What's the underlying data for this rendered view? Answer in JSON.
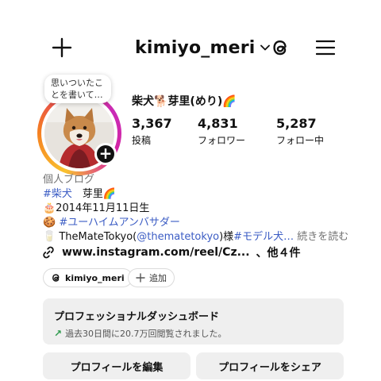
{
  "header": {
    "username": "kimiyo_meri",
    "icons": [
      "plus-icon",
      "chevron-down-icon",
      "threads-icon",
      "hamburger-menu-icon"
    ]
  },
  "profile": {
    "note": "思いついたことを書いて…",
    "display_name": "柴犬🐕芽里(めり)🌈",
    "stats": {
      "posts": {
        "value": "3,367",
        "label": "投稿"
      },
      "followers": {
        "value": "4,831",
        "label": "フォロワー"
      },
      "following": {
        "value": "5,287",
        "label": "フォロー中"
      }
    }
  },
  "bio": {
    "category": "個人ブログ",
    "line1_tag": "#柴犬",
    "line1_text": "　芽里🌈",
    "line2": "🎂2014年11月11日生",
    "line3_emoji": "🍪",
    "line3_tag": "#ユーハイムアンバサダー",
    "line4_emoji": "🥛",
    "line4_text_a": "TheMateTokyo(",
    "line4_mention": "@thematetokyo",
    "line4_text_b": ")様",
    "line4_tag": "#モデル犬…",
    "line4_more": "続きを読む",
    "link": "www.instagram.com/reel/Cz...",
    "link_extra": "、他４件"
  },
  "chips": {
    "threads_label": "kimiyo_meri",
    "add_label": "追加"
  },
  "dashboard": {
    "title": "プロフェッショナルダッシュボード",
    "subtitle": "過去30日間に20.7万回閲覧されました。"
  },
  "actions": {
    "edit": "プロフィールを編集",
    "share": "プロフィールをシェア"
  },
  "colors": {
    "hashtag": "#3b5cc4",
    "trend_up": "#2e9a4d",
    "button_bg": "#efefef"
  }
}
